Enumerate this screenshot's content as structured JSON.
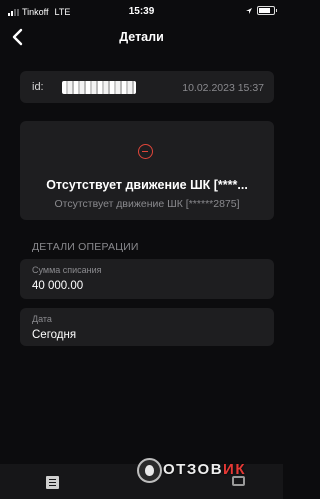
{
  "status_bar": {
    "carrier": "Tinkoff",
    "network": "LTE",
    "time": "15:39",
    "signal_bars": 2,
    "battery_fraction": 0.75
  },
  "nav": {
    "back_icon": "chevron-left-icon",
    "title": "Детали"
  },
  "operation": {
    "id_label": "id:",
    "datetime": "10.02.2023 15:37",
    "status_icon": "error-circle-icon",
    "status_color": "#e0463a",
    "status_title": "Отсутствует движение ШК [****...",
    "status_subtitle": "Отсутствует движение ШК [******2875]"
  },
  "details": {
    "section_title": "ДЕТАЛИ ОПЕРАЦИИ",
    "fields": [
      {
        "label": "Сумма списания",
        "value": "40 000.00"
      },
      {
        "label": "Дата",
        "value": "Сегодня"
      }
    ]
  },
  "tab_bar": {
    "icons": [
      "document-icon",
      "chat-icon"
    ]
  },
  "watermark": {
    "text": "ОТЗОВ",
    "accent": "ИК"
  }
}
